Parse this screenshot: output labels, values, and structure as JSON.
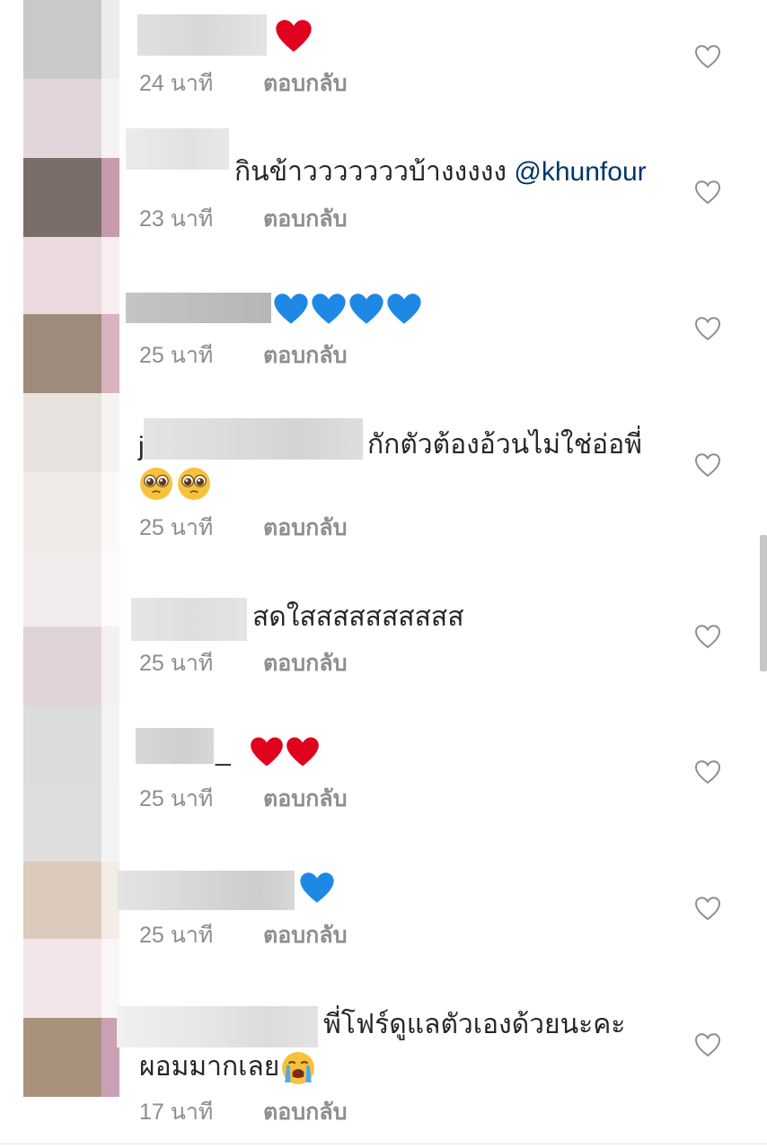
{
  "comments": [
    {
      "text": "",
      "emoji": "red-heart",
      "time": "24 นาที",
      "reply": "ตอบกลับ"
    },
    {
      "text": "กินข้าวววววววบ้างงงงง ",
      "mention": "@khunfour",
      "time": "23 นาที",
      "reply": "ตอบกลับ"
    },
    {
      "text": "",
      "emoji": "blue-heart x4",
      "time": "25 นาที",
      "reply": "ตอบกลับ"
    },
    {
      "prefix": "j",
      "text": "กักตัวต้องอ้วนไม่ใช่อ่อพี่",
      "emoji": "pleading-face x2",
      "time": "25 นาที",
      "reply": "ตอบกลับ"
    },
    {
      "text": "สดใสสสสสสสสสส",
      "time": "25 นาที",
      "reply": "ตอบกลับ"
    },
    {
      "text": "_",
      "emoji": "red-heart x2",
      "time": "25 นาที",
      "reply": "ตอบกลับ"
    },
    {
      "text": "",
      "emoji": "blue-heart",
      "time": "25 นาที",
      "reply": "ตอบกลับ"
    },
    {
      "text": "พี่โฟร์ดูแลตัวเองด้วยนะคะ",
      "text2": "ผอมมากเลย",
      "emoji": "crying-face",
      "time": "17 นาที",
      "reply": "ตอบกลับ"
    }
  ],
  "colors": {
    "meta": "#8e8e8e",
    "mention": "#003569",
    "text": "#262626",
    "heart_outline": "#8e8e8e"
  }
}
